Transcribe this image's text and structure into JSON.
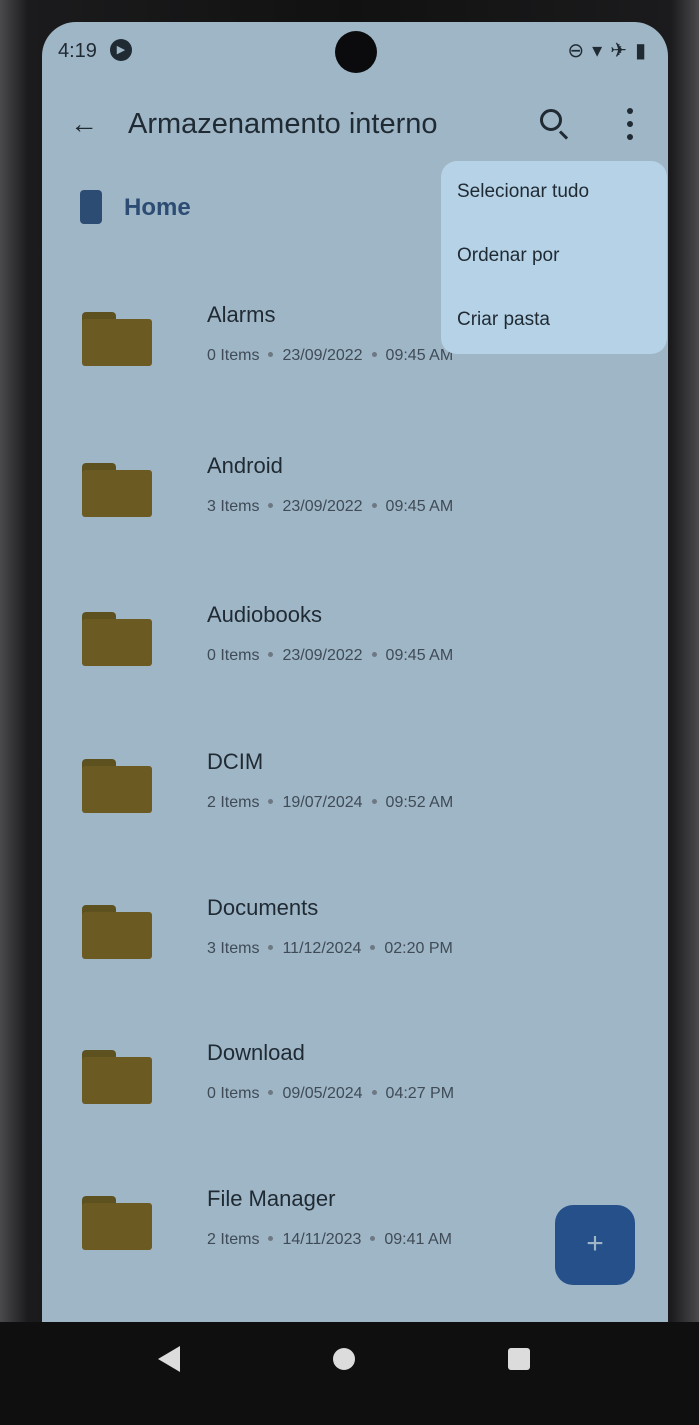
{
  "status_bar": {
    "time": "4:19",
    "rec_icon": "play-icon",
    "icons": [
      "dnd-icon",
      "wifi-icon",
      "airplane-icon",
      "battery-icon"
    ]
  },
  "app_bar": {
    "back_icon": "arrow-left-icon",
    "title": "Armazenamento interno",
    "search_icon": "search-icon",
    "more_icon": "more-vert-icon"
  },
  "breadcrumb": {
    "icon": "storage-icon",
    "label": "Home"
  },
  "overflow_menu": {
    "items": [
      {
        "label": "Selecionar tudo"
      },
      {
        "label": "Ordenar por"
      },
      {
        "label": "Criar pasta"
      }
    ]
  },
  "files": [
    {
      "name": "Alarms",
      "items": "0 Items",
      "date": "23/09/2022",
      "time": "09:45 AM"
    },
    {
      "name": "Android",
      "items": "3 Items",
      "date": "23/09/2022",
      "time": "09:45 AM"
    },
    {
      "name": "Audiobooks",
      "items": "0 Items",
      "date": "23/09/2022",
      "time": "09:45 AM"
    },
    {
      "name": "DCIM",
      "items": "2 Items",
      "date": "19/07/2024",
      "time": "09:52 AM"
    },
    {
      "name": "Documents",
      "items": "3 Items",
      "date": "11/12/2024",
      "time": "02:20 PM"
    },
    {
      "name": "Download",
      "items": "0 Items",
      "date": "09/05/2024",
      "time": "04:27 PM"
    },
    {
      "name": "File Manager",
      "items": "2 Items",
      "date": "14/11/2023",
      "time": "09:41 AM"
    }
  ],
  "fab": {
    "label": "+"
  },
  "colors": {
    "screen_bg": "#9fb6c6",
    "menu_bg": "#b6d2e6",
    "folder": "#6b5b22",
    "accent": "#26508a"
  }
}
